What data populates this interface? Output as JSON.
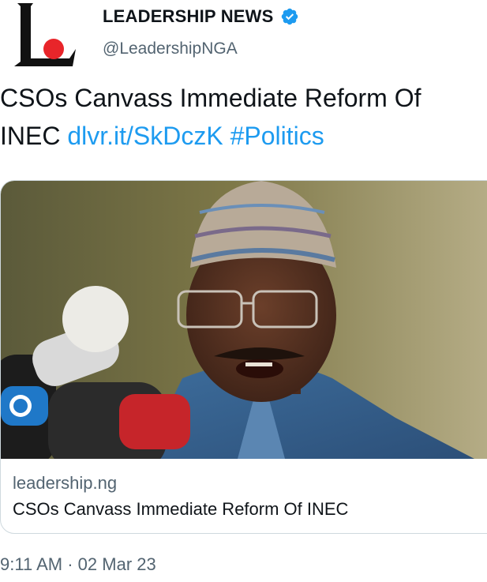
{
  "author": {
    "display_name": "LEADERSHIP NEWS",
    "handle": "@LeadershipNGA",
    "avatar_icon": "leadership-logo-icon",
    "verified_icon": "verified-badge-icon"
  },
  "tweet": {
    "text": "CSOs Canvass Immediate Reform Of INEC",
    "link": "dlvr.it/SkDczK",
    "hashtag": "#Politics"
  },
  "card": {
    "image_subject": "Man in embroidered cap speaking into microphones",
    "domain": "leadership.ng",
    "title": "CSOs Canvass Immediate Reform Of INEC"
  },
  "meta": {
    "time": "9:11 AM",
    "separator": "·",
    "date": "02 Mar 23"
  },
  "colors": {
    "link": "#1d9bf0",
    "secondary_text": "#536471",
    "primary_text": "#0f1419",
    "logo_red": "#e8252a"
  }
}
